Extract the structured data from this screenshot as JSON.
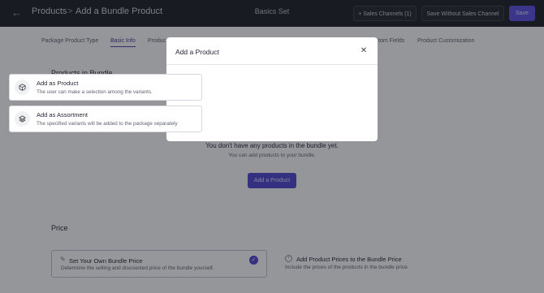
{
  "header": {
    "breadcrumb_root": "Products",
    "breadcrumb_sep": ">",
    "breadcrumb_current": "Add a Bundle Product",
    "center_title": "Basics Set",
    "sales_channels_label": "+ Sales Channels (1)",
    "save_without_label": "Save Without Sales Channel",
    "save_label": "Save"
  },
  "tabs": [
    {
      "label": "Package Product Type"
    },
    {
      "label": "Basic Info"
    },
    {
      "label": "Produc"
    },
    {
      "label": "tom Fields"
    },
    {
      "label": "Product Customization"
    }
  ],
  "products_section": {
    "title": "Products in Bundle",
    "empty_title": "You don't have any products in the bundle yet.",
    "empty_sub": "You can add products to your bundle.",
    "add_button": "Add a Product"
  },
  "price_section": {
    "title": "Price",
    "option1_title": "Set Your Own Bundle Price",
    "option1_desc": "Determine the selling and discounted price of the bundle yourself.",
    "option2_title": "Add Product Prices to the Bundle Price",
    "option2_desc": "Include the prices of the products in the bundle price."
  },
  "modal": {
    "title": "Add a Product",
    "options": [
      {
        "title": "Add as Product",
        "desc": "The user can make a selection among the variants.",
        "icon": "box-icon"
      },
      {
        "title": "Add as Assortment",
        "desc": "The specified variants will be added to the package separately",
        "icon": "layers-icon"
      }
    ]
  },
  "colors": {
    "accent": "#4f46c9",
    "topbar": "#1c1f26"
  }
}
